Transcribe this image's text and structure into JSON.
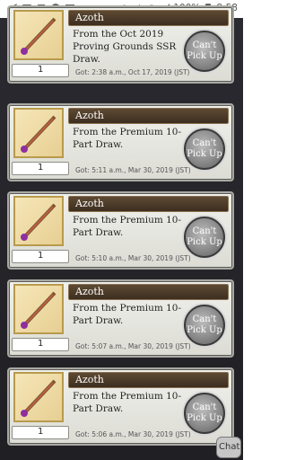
{
  "status_bar": {
    "battery": "100%",
    "time": "8:58"
  },
  "cards": [
    {
      "name": "Azoth",
      "desc": "From the Oct 2019 Proving Grounds SSR Draw.",
      "count": "1",
      "got": "Got: 2:38 a.m., Oct 17, 2019 (JST)",
      "button": "Can't Pick Up"
    },
    {
      "name": "Azoth",
      "desc": "From the Premium 10-Part Draw.",
      "count": "1",
      "got": "Got: 5:11 a.m., Mar 30, 2019 (JST)",
      "button": "Can't Pick Up"
    },
    {
      "name": "Azoth",
      "desc": "From the Premium 10-Part Draw.",
      "count": "1",
      "got": "Got: 5:10 a.m., Mar 30, 2019 (JST)",
      "button": "Can't Pick Up"
    },
    {
      "name": "Azoth",
      "desc": "From the Premium 10-Part Draw.",
      "count": "1",
      "got": "Got: 5:07 a.m., Mar 30, 2019 (JST)",
      "button": "Can't Pick Up"
    },
    {
      "name": "Azoth",
      "desc": "From the Premium 10-Part Draw.",
      "count": "1",
      "got": "Got: 5:06 a.m., Mar 30, 2019 (JST)",
      "button": "Can't Pick Up"
    }
  ],
  "chat": {
    "label": "Chat"
  }
}
